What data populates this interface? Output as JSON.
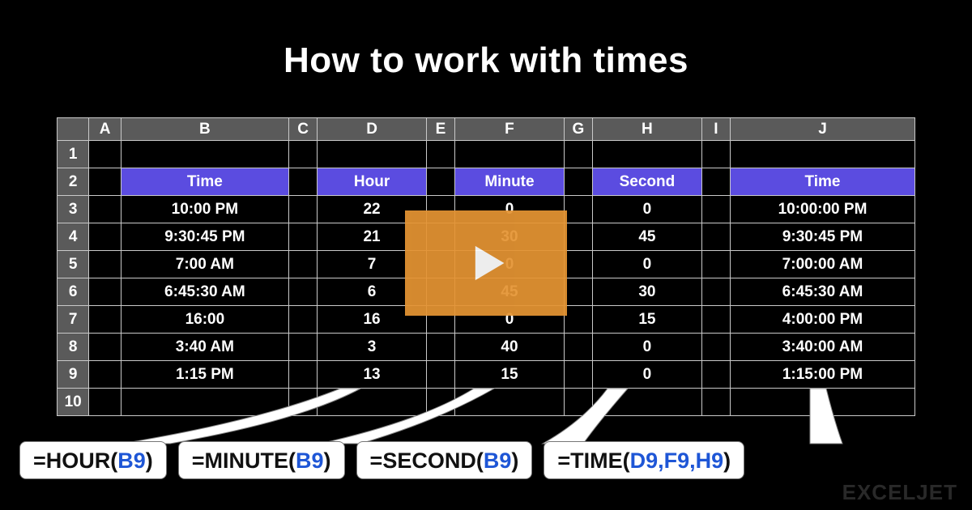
{
  "title": "How to work with times",
  "watermark": "EXCELJET",
  "columns": [
    "A",
    "B",
    "C",
    "D",
    "E",
    "F",
    "G",
    "H",
    "I",
    "J"
  ],
  "rowNumbers": [
    "1",
    "2",
    "3",
    "4",
    "5",
    "6",
    "7",
    "8",
    "9",
    "10"
  ],
  "headers": {
    "B": "Time",
    "D": "Hour",
    "F": "Minute",
    "H": "Second",
    "J": "Time"
  },
  "rows": [
    {
      "B": "10:00 PM",
      "D": "22",
      "F": "0",
      "H": "0",
      "J": "10:00:00 PM"
    },
    {
      "B": "9:30:45 PM",
      "D": "21",
      "F": "30",
      "H": "45",
      "J": "9:30:45 PM"
    },
    {
      "B": "7:00 AM",
      "D": "7",
      "F": "0",
      "H": "0",
      "J": "7:00:00 AM"
    },
    {
      "B": "6:45:30 AM",
      "D": "6",
      "F": "45",
      "H": "30",
      "J": "6:45:30 AM"
    },
    {
      "B": "16:00",
      "D": "16",
      "F": "0",
      "H": "15",
      "J": "4:00:00 PM"
    },
    {
      "B": "3:40 AM",
      "D": "3",
      "F": "40",
      "H": "0",
      "J": "3:40:00 AM"
    },
    {
      "B": "1:15 PM",
      "D": "13",
      "F": "15",
      "H": "0",
      "J": "1:15:00 PM"
    }
  ],
  "formulas": {
    "hour": {
      "pre": "=HOUR(",
      "ref": "B9",
      "post": ")"
    },
    "minute": {
      "pre": "=MINUTE(",
      "ref": "B9",
      "post": ")"
    },
    "second": {
      "pre": "=SECOND(",
      "ref": "B9",
      "post": ")"
    },
    "time": {
      "pre": "=TIME(",
      "ref": "D9,F9,H9",
      "post": ")"
    }
  }
}
